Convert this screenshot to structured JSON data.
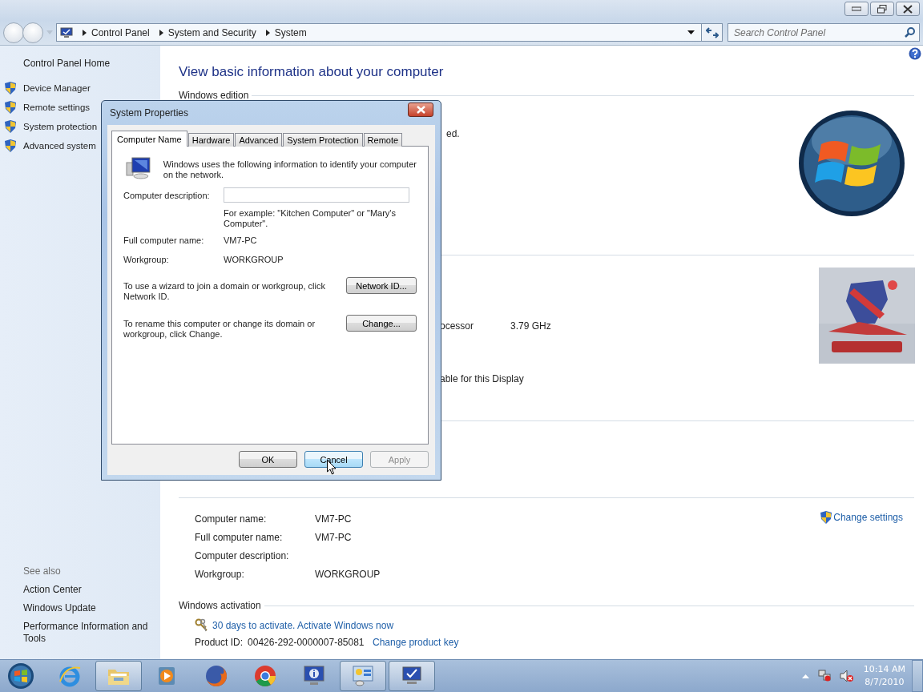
{
  "address_bar": {
    "breadcrumbs": [
      "Control Panel",
      "System and Security",
      "System"
    ]
  },
  "search": {
    "placeholder": "Search Control Panel"
  },
  "sidebar": {
    "home": "Control Panel Home",
    "tasks": [
      "Device Manager",
      "Remote settings",
      "System protection",
      "Advanced system"
    ],
    "see_also_title": "See also",
    "see_also": [
      "Action Center",
      "Windows Update",
      "Performance Information and Tools"
    ]
  },
  "main": {
    "heading": "View basic information about your computer",
    "edition": {
      "title": "Windows edition",
      "fragment": "ed."
    },
    "system": {
      "processor_fragment": "ocessor",
      "processor_speed": "3.79 GHz",
      "display_fragment": "able for this Display"
    },
    "computer_name": {
      "change_settings": "Change settings",
      "rows": [
        {
          "label": "Computer name:",
          "value": "VM7-PC"
        },
        {
          "label": "Full computer name:",
          "value": "VM7-PC"
        },
        {
          "label": "Computer description:"
        },
        {
          "label": "Workgroup:",
          "value": "WORKGROUP"
        }
      ]
    },
    "activation": {
      "title": "Windows activation",
      "link": "30 days to activate. Activate Windows now",
      "product_id_label": "Product ID:",
      "product_id": "00426-292-0000007-85081",
      "change_key": "Change product key"
    }
  },
  "dialog": {
    "title": "System Properties",
    "tabs": [
      {
        "label": "Computer Name",
        "selected": true
      },
      {
        "label": "Hardware",
        "selected": false
      },
      {
        "label": "Advanced",
        "selected": false
      },
      {
        "label": "System Protection",
        "selected": false
      },
      {
        "label": "Remote",
        "selected": false
      }
    ],
    "intro": "Windows uses the following information to identify your computer on the network.",
    "description_label": "Computer description:",
    "description_hint": "For example: \"Kitchen Computer\" or \"Mary's Computer\".",
    "fields": [
      {
        "label": "Full computer name:",
        "value": "VM7-PC"
      },
      {
        "label": "Workgroup:",
        "value": "WORKGROUP"
      }
    ],
    "actions": [
      {
        "text": "To use a wizard to join a domain or workgroup, click Network ID.",
        "button": "Network ID..."
      },
      {
        "text": "To rename this computer or change its domain or workgroup, click Change.",
        "button": "Change..."
      }
    ],
    "buttons": [
      {
        "label": "OK",
        "focused": false,
        "disabled": false
      },
      {
        "label": "Cancel",
        "focused": true,
        "disabled": false
      },
      {
        "label": "Apply",
        "focused": false,
        "disabled": true
      }
    ]
  },
  "taskbar": {
    "apps": [
      {
        "kind": "ie",
        "active": false
      },
      {
        "kind": "explorer",
        "active": true
      },
      {
        "kind": "media",
        "active": false
      },
      {
        "kind": "firefox",
        "active": false
      },
      {
        "kind": "chrome",
        "active": false
      },
      {
        "kind": "info",
        "active": false
      },
      {
        "kind": "control_panel",
        "active": true
      },
      {
        "kind": "system",
        "active": true
      }
    ],
    "time": "10:14 AM",
    "date": "8/7/2010"
  }
}
